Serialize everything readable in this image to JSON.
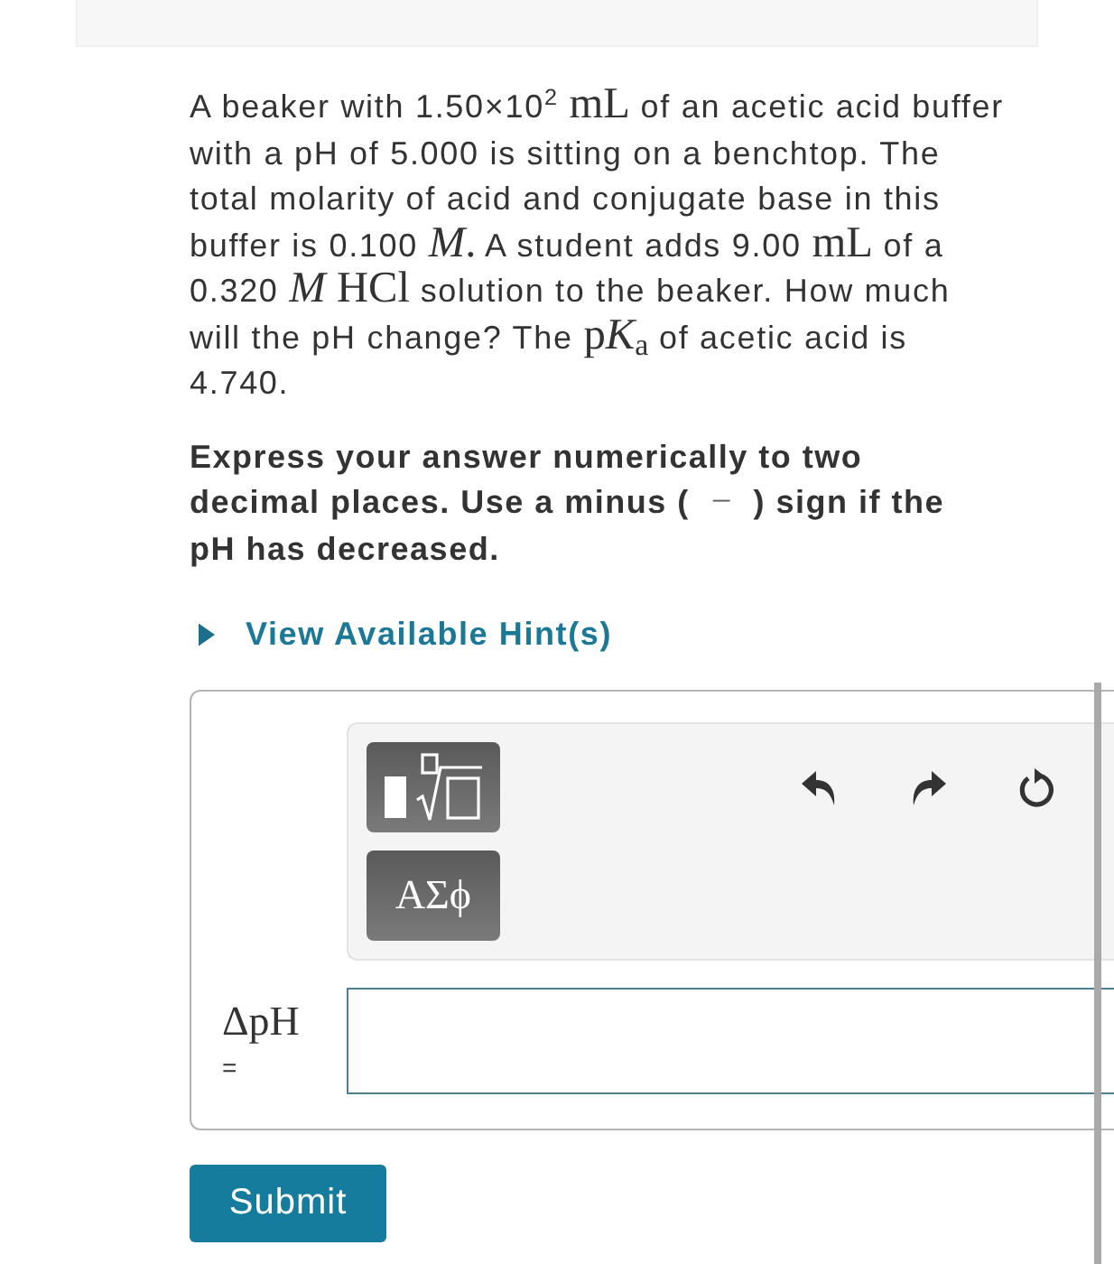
{
  "question": {
    "segments": [
      {
        "kind": "text",
        "text": "A beaker with 1.50×10$^{2}$ "
      },
      {
        "kind": "math",
        "text": "mL"
      },
      {
        "kind": "text",
        "text": " of an acetic acid buffer with a pH of 5.000 is sitting on a benchtop. The total molarity of acid and conjugate base in this buffer is 0.100 "
      },
      {
        "kind": "math",
        "text": "*M*."
      },
      {
        "kind": "text",
        "text": " A student adds 9.00 "
      },
      {
        "kind": "math",
        "text": "mL"
      },
      {
        "kind": "text",
        "text": " of a 0.320 "
      },
      {
        "kind": "math",
        "text": "*M* HCl"
      },
      {
        "kind": "text",
        "text": " solution to the beaker. How much will the pH change? The "
      },
      {
        "kind": "math",
        "text": "p"
      },
      {
        "kind": "math_variable",
        "text": "K"
      },
      {
        "kind": "math",
        "text": "$_{a}$"
      },
      {
        "kind": "text",
        "text": " of acetic acid is 4.740."
      }
    ]
  },
  "instructions": {
    "segments": [
      {
        "kind": "text",
        "text": "Express your answer numerically to two decimal places. Use a minus ("
      },
      {
        "kind": "math",
        "text": "−"
      },
      {
        "kind": "text",
        "text": ") sign if the pH has decreased."
      }
    ]
  },
  "hint": {
    "label": "View Available Hint(s)",
    "expanded": false
  },
  "answer": {
    "symbols_button": {
      "label": "ΑΣϕ"
    },
    "label": "ΔpH",
    "relation": "="
  },
  "submit": {
    "label": "Submit"
  }
}
